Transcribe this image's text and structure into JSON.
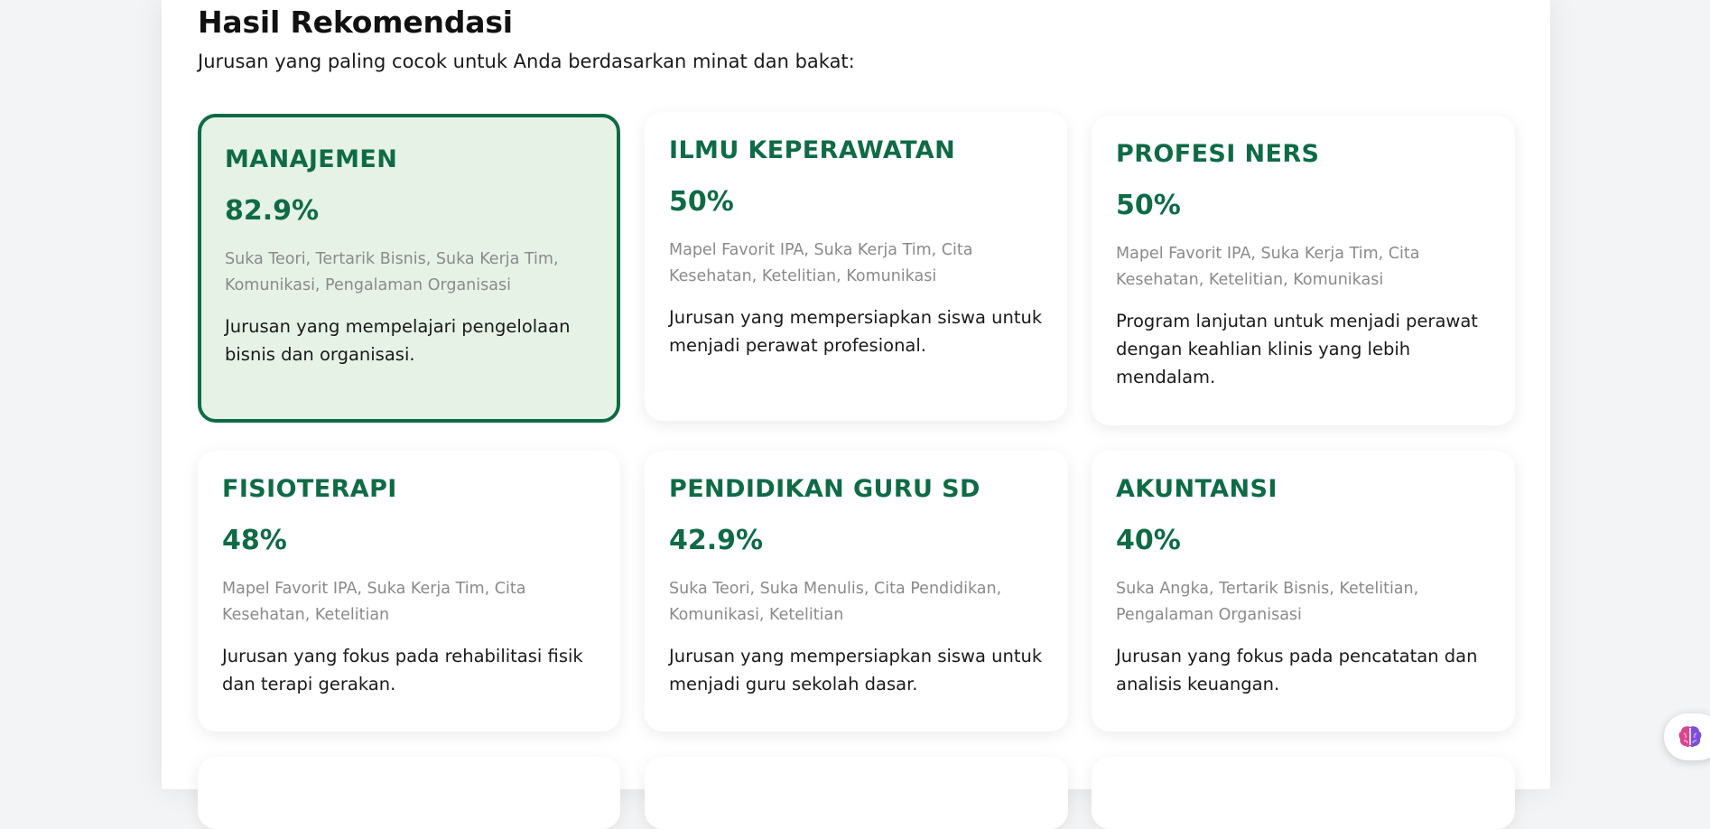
{
  "header": {
    "title": "Hasil Rekomendasi",
    "subtitle": "Jurusan yang paling cocok untuk Anda berdasarkan minat dan bakat:"
  },
  "cards": [
    {
      "title": "MANAJEMEN",
      "score": "82.9%",
      "tags": "Suka Teori, Tertarik Bisnis, Suka Kerja Tim, Komunikasi, Pengalaman Organisasi",
      "description": "Jurusan yang mempelajari pengelolaan bisnis dan organisasi.",
      "selected": true
    },
    {
      "title": "ILMU KEPERAWATAN",
      "score": "50%",
      "tags": "Mapel Favorit IPA, Suka Kerja Tim, Cita Kesehatan, Ketelitian, Komunikasi",
      "description": "Jurusan yang mempersiapkan siswa untuk menjadi perawat profesional.",
      "selected": false
    },
    {
      "title": "PROFESI NERS",
      "score": "50%",
      "tags": "Mapel Favorit IPA, Suka Kerja Tim, Cita Kesehatan, Ketelitian, Komunikasi",
      "description": "Program lanjutan untuk menjadi perawat dengan keahlian klinis yang lebih mendalam.",
      "selected": false
    },
    {
      "title": "FISIOTERAPI",
      "score": "48%",
      "tags": "Mapel Favorit IPA, Suka Kerja Tim, Cita Kesehatan, Ketelitian",
      "description": "Jurusan yang fokus pada rehabilitasi fisik dan terapi gerakan.",
      "selected": false
    },
    {
      "title": "PENDIDIKAN GURU SD",
      "score": "42.9%",
      "tags": "Suka Teori, Suka Menulis, Cita Pendidikan, Komunikasi, Ketelitian",
      "description": "Jurusan yang mempersiapkan siswa untuk menjadi guru sekolah dasar.",
      "selected": false
    },
    {
      "title": "AKUNTANSI",
      "score": "40%",
      "tags": "Suka Angka, Tertarik Bisnis, Ketelitian, Pengalaman Organisasi",
      "description": "Jurusan yang fokus pada pencatatan dan analisis keuangan.",
      "selected": false
    }
  ],
  "colors": {
    "accent": "#0f6b46",
    "selected_background": "#e6f2e5"
  },
  "floating_button": {
    "icon": "brain-icon"
  }
}
